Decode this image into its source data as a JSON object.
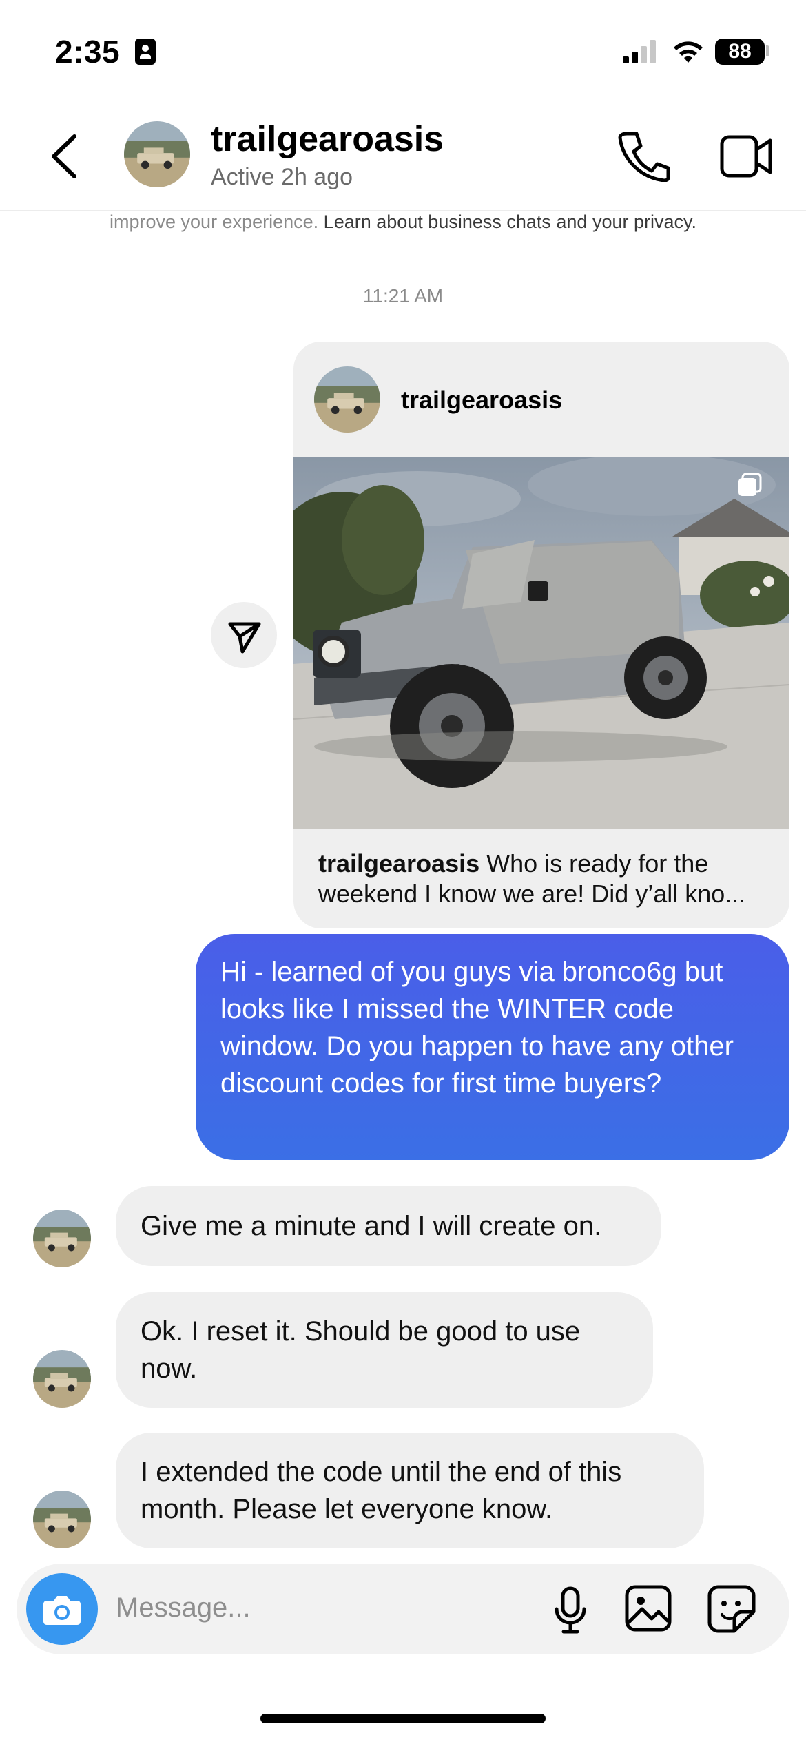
{
  "status_bar": {
    "time": "2:35",
    "battery": "88"
  },
  "header": {
    "name": "trailgearoasis",
    "status": "Active 2h ago"
  },
  "notice": {
    "text": "improve your experience.",
    "link": "Learn about business chats and your privacy."
  },
  "timestamp": "11:21 AM",
  "shared_post": {
    "author": "trailgearoasis",
    "caption_author": "trailgearoasis",
    "caption_text": "Who is ready for the weekend I know we are! Did y’all kno..."
  },
  "messages": {
    "outgoing": "Hi - learned of you guys via bronco6g but looks like I missed the WINTER code window. Do you happen to have any other discount codes for first time buyers?",
    "incoming": [
      {
        "text": "Give me a minute and I will create on."
      },
      {
        "text": "Ok. I reset it. Should be good to use now."
      },
      {
        "text": "I extended the code until the end of this month. Please let everyone know."
      }
    ]
  },
  "composer": {
    "placeholder": "Message..."
  },
  "colors": {
    "outgoing_bubble": "#4a5ee8",
    "incoming_bubble": "#efefef",
    "camera_button": "#3797f0"
  },
  "icons": [
    "back-chevron-icon",
    "phone-icon",
    "video-camera-icon",
    "send-share-icon",
    "multi-photo-icon",
    "camera-icon",
    "microphone-icon",
    "gallery-icon",
    "sticker-icon",
    "signal-icon",
    "wifi-icon",
    "id-badge-icon"
  ]
}
